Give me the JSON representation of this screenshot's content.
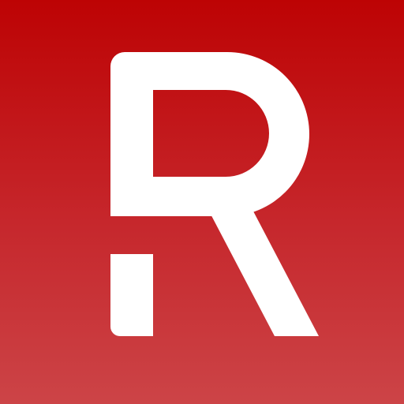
{
  "icon": {
    "semantic": "letter-r-logo-icon",
    "glyph": "R",
    "colors": {
      "background_top": "#bd0304",
      "background_mid": "#c6272c",
      "background_bottom": "#cc4447",
      "glyph": "#ffffff"
    }
  }
}
